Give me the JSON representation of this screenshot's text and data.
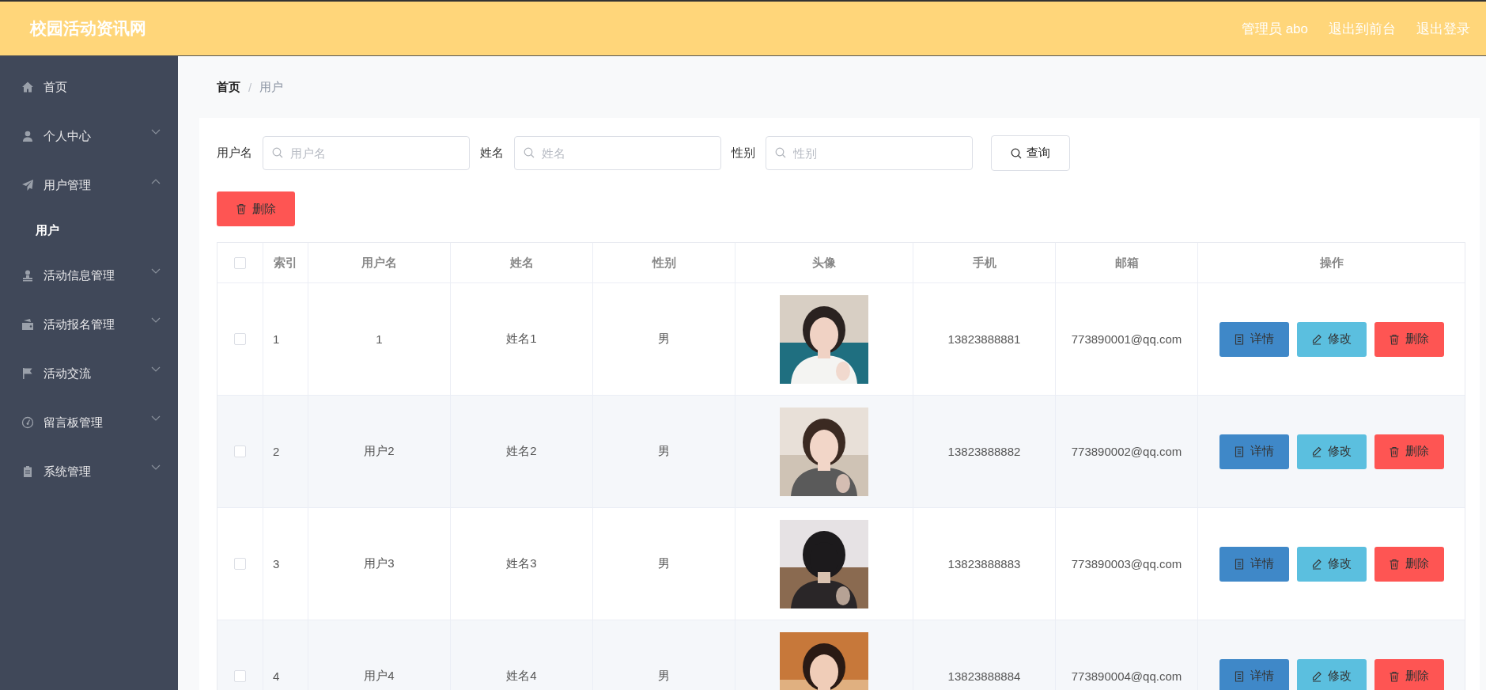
{
  "header": {
    "title": "校园活动资讯网",
    "links": [
      "管理员 abo",
      "退出到前台",
      "退出登录"
    ]
  },
  "sidebar": {
    "items": [
      {
        "label": "首页",
        "kind": "link"
      },
      {
        "label": "个人中心",
        "kind": "menu",
        "expanded": false
      },
      {
        "label": "用户管理",
        "kind": "menu",
        "expanded": true,
        "children": [
          {
            "label": "用户",
            "selected": true
          }
        ]
      },
      {
        "label": "活动信息管理",
        "kind": "menu",
        "expanded": false
      },
      {
        "label": "活动报名管理",
        "kind": "menu",
        "expanded": false
      },
      {
        "label": "活动交流",
        "kind": "menu",
        "expanded": false
      },
      {
        "label": "留言板管理",
        "kind": "menu",
        "expanded": false
      },
      {
        "label": "系统管理",
        "kind": "menu",
        "expanded": false
      }
    ]
  },
  "breadcrumb": [
    "首页",
    "用户"
  ],
  "breadcrumb_separator": "/",
  "search": {
    "fields": [
      {
        "label": "用户名",
        "placeholder": "用户名"
      },
      {
        "label": "姓名",
        "placeholder": "姓名"
      },
      {
        "label": "性别",
        "placeholder": "性别"
      }
    ],
    "button": "查询"
  },
  "delete_button": "删除",
  "table": {
    "select_all_checked": false,
    "columns": [
      "索引",
      "用户名",
      "姓名",
      "性别",
      "头像",
      "手机",
      "邮箱",
      "操作"
    ],
    "rows": [
      {
        "checked": false,
        "index": "1",
        "username": "1",
        "name": "姓名1",
        "gender": "男",
        "phone": "13823888881",
        "email": "773890001@qq.com",
        "actions": [
          {
            "label": "详情",
            "kind": "detail"
          },
          {
            "label": "修改",
            "kind": "edit"
          },
          {
            "label": "删除",
            "kind": "delete"
          }
        ]
      },
      {
        "checked": false,
        "index": "2",
        "username": "用户2",
        "name": "姓名2",
        "gender": "男",
        "phone": "13823888882",
        "email": "773890002@qq.com",
        "actions": [
          {
            "label": "详情",
            "kind": "detail"
          },
          {
            "label": "修改",
            "kind": "edit"
          },
          {
            "label": "删除",
            "kind": "delete"
          }
        ]
      },
      {
        "checked": false,
        "index": "3",
        "username": "用户3",
        "name": "姓名3",
        "gender": "男",
        "phone": "13823888883",
        "email": "773890003@qq.com",
        "actions": [
          {
            "label": "详情",
            "kind": "detail"
          },
          {
            "label": "修改",
            "kind": "edit"
          },
          {
            "label": "删除",
            "kind": "delete"
          }
        ]
      },
      {
        "checked": false,
        "index": "4",
        "username": "用户4",
        "name": "姓名4",
        "gender": "男",
        "phone": "13823888884",
        "email": "773890004@qq.com",
        "actions": [
          {
            "label": "详情",
            "kind": "detail"
          },
          {
            "label": "修改",
            "kind": "edit"
          },
          {
            "label": "删除",
            "kind": "delete"
          }
        ]
      }
    ]
  }
}
